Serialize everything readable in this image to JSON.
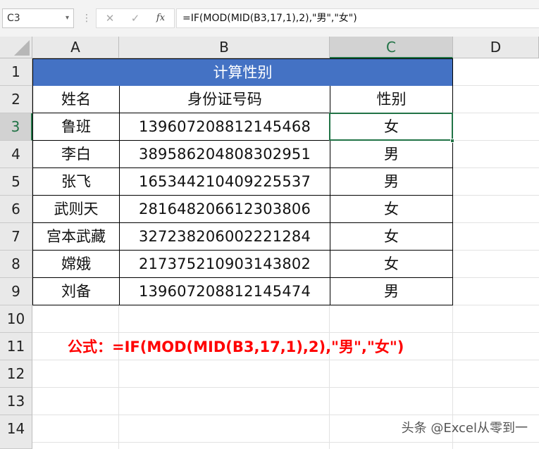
{
  "formula_bar": {
    "name_box": "C3",
    "name_box_caret": "▾",
    "separator": "⋮",
    "cancel_glyph": "✕",
    "confirm_glyph": "✓",
    "fx_glyph": "fx",
    "formula": "=IF(MOD(MID(B3,17,1),2),\"男\",\"女\")"
  },
  "columns": [
    "A",
    "B",
    "C",
    "D"
  ],
  "rows": [
    "1",
    "2",
    "3",
    "4",
    "5",
    "6",
    "7",
    "8",
    "9",
    "10",
    "11",
    "12",
    "13",
    "14"
  ],
  "active_cell": {
    "column": "C",
    "row": "3"
  },
  "table": {
    "title": "计算性别",
    "headers": [
      "姓名",
      "身份证号码",
      "性别"
    ],
    "data": [
      [
        "鲁班",
        "139607208812145468",
        "女"
      ],
      [
        "李白",
        "389586204808302951",
        "男"
      ],
      [
        "张飞",
        "165344210409225537",
        "男"
      ],
      [
        "武则天",
        "281648206612303806",
        "女"
      ],
      [
        "宫本武藏",
        "327238206002221284",
        "女"
      ],
      [
        "嫦娥",
        "217375210903143802",
        "女"
      ],
      [
        "刘备",
        "139607208812145474",
        "男"
      ]
    ],
    "title_color": "#4472c4"
  },
  "note": {
    "text": "公式：=IF(MOD(MID(B3,17,1),2),\"男\",\"女\")",
    "color": "#ff0000"
  },
  "watermark": "头条 @Excel从零到一",
  "accent_color": "#217346"
}
